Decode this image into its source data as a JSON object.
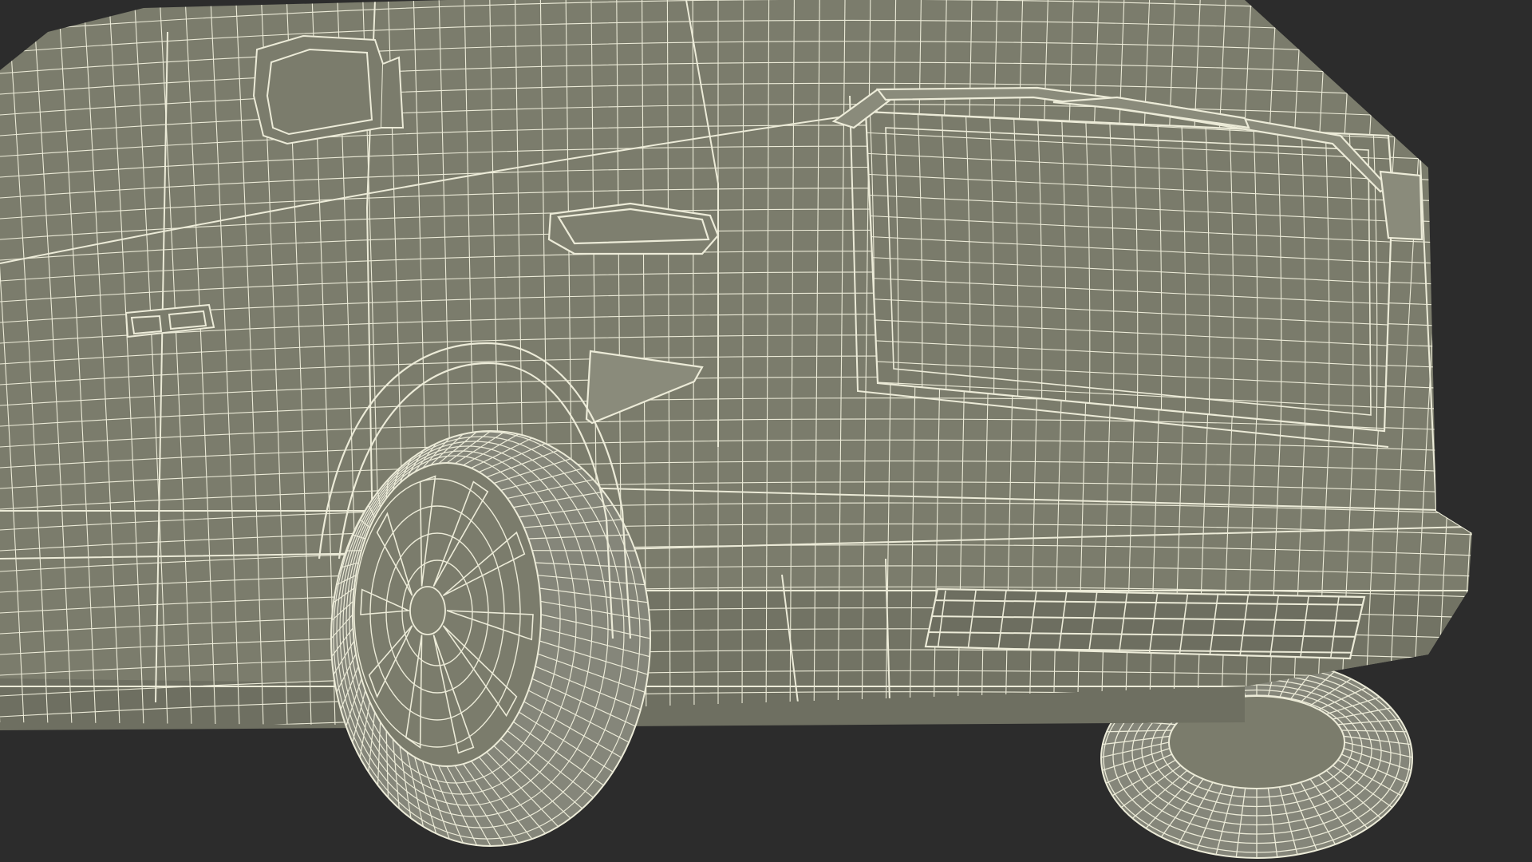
{
  "scene": {
    "background_color": "#2c2c2c",
    "body_fill_color": "#7b7c6c",
    "body_shade_color": "#6c6d5f",
    "wire_color": "#ecebd8",
    "tire_fill_color": "#85867a",
    "subject": "wireframe-van-front-quarter"
  }
}
